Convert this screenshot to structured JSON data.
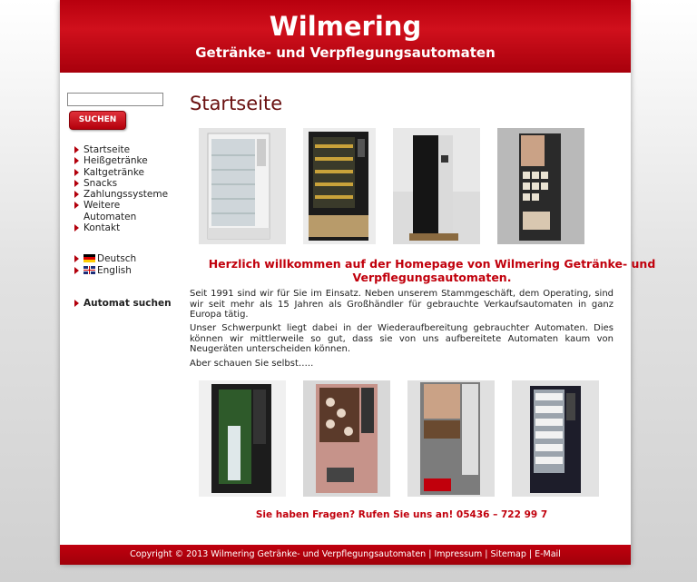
{
  "header": {
    "brand": "Wilmering",
    "tagline": "Getränke- und Verpflegungsautomaten"
  },
  "search": {
    "value": "",
    "button_label": "SUCHEN"
  },
  "nav": {
    "items": [
      "Startseite",
      "Heißgetränke",
      "Kaltgetränke",
      "Snacks",
      "Zahlungssysteme",
      "Weitere Automaten",
      "Kontakt"
    ]
  },
  "languages": [
    "Deutsch",
    "English"
  ],
  "finder_label": "Automat suchen",
  "main": {
    "title": "Startseite",
    "welcome": "Herzlich willkommen auf der Homepage von Wilmering Getränke- und Verpflegungsautomaten.",
    "paragraphs": [
      "Seit 1991 sind wir für Sie im Einsatz. Neben unserem Stammgeschäft, dem Operating, sind wir seit mehr als 15 Jahren als Großhändler für gebrauchte Verkaufsautomaten in ganz Europa tätig.",
      "Unser Schwerpunkt liegt dabei in der Wiederaufbereitung gebrauchter Automaten. Dies können wir mittlerweile so gut, dass sie von uns aufbereitete Automaten kaum von Neugeräten unterscheiden können.",
      "Aber schauen Sie selbst….."
    ],
    "contact": "Sie haben Fragen? Rufen Sie uns an! 05436 – 722 99 7"
  },
  "footer": {
    "copyright": "Copyright © 2013 Wilmering Getränke- und Verpflegungsautomaten",
    "links": [
      "Impressum",
      "Sitemap",
      "E-Mail"
    ]
  },
  "colors": {
    "brand_red": "#c1000c",
    "title_brown": "#6a1010"
  }
}
